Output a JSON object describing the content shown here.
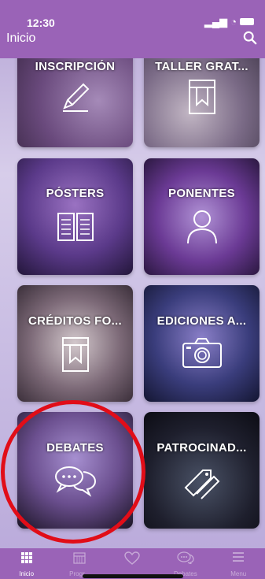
{
  "status_bar": {
    "time": "12:30",
    "signal": "▂▄▆",
    "wifi": "◔"
  },
  "header": {
    "title": "Inicio"
  },
  "tiles": [
    {
      "label": "INSCRIPCIÓN",
      "icon": "pencil-icon",
      "color": "#6a4a7d"
    },
    {
      "label": "TALLER GRAT...",
      "icon": "bookmark-icon",
      "color": "#6b5a7b"
    },
    {
      "label": "PÓSTERS",
      "icon": "book-icon",
      "color": "#5b3a8a"
    },
    {
      "label": "PONENTES",
      "icon": "person-icon",
      "color": "#6b3a95"
    },
    {
      "label": "CRÉDITOS FO...",
      "icon": "bookmark-icon",
      "color": "#7d6a78"
    },
    {
      "label": "EDICIONES A...",
      "icon": "camera-icon",
      "color": "#3a3d7c"
    },
    {
      "label": "DEBATES",
      "icon": "chat-icon",
      "color": "#6b4f8f"
    },
    {
      "label": "PATROCINAD...",
      "icon": "tag-icon",
      "color": "#1e1f2d"
    }
  ],
  "bottom_nav": [
    {
      "label": "Inicio",
      "icon": "grid-icon"
    },
    {
      "label": "Progr...",
      "icon": "calendar-icon"
    },
    {
      "label": "",
      "icon": "heart-icon"
    },
    {
      "label": "Debates",
      "icon": "chat-icon"
    },
    {
      "label": "Menu",
      "icon": "menu-icon"
    }
  ],
  "colors": {
    "brand": "#9a63b7",
    "highlight": "#e10d18"
  }
}
